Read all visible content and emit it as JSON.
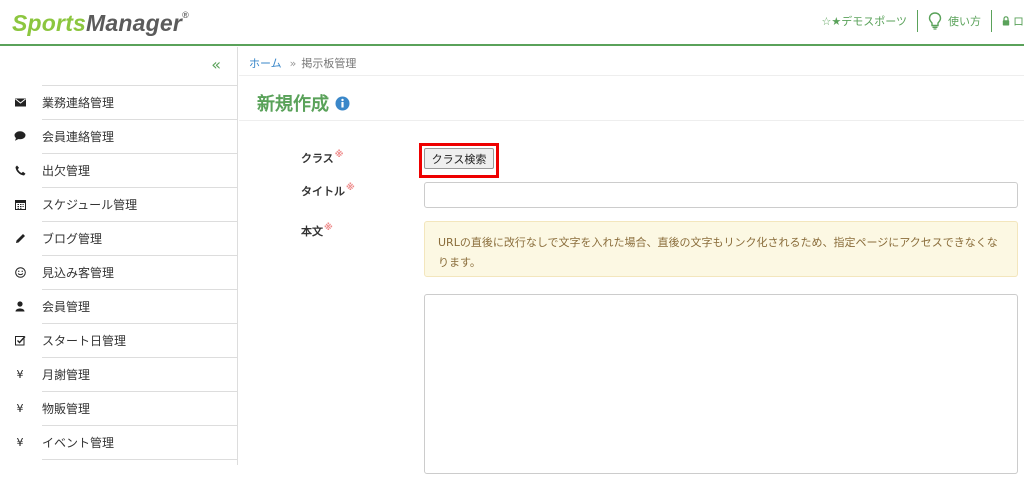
{
  "header": {
    "logo": {
      "sports": "Sports",
      "manager": "Manager"
    },
    "nav": {
      "org": "☆★デモスポーツ",
      "help": "使い方",
      "logout": "ロ"
    }
  },
  "sidebar": {
    "collapse_symbol": "«",
    "items": [
      {
        "label": "業務連絡管理",
        "icon": "envelope-icon"
      },
      {
        "label": "会員連絡管理",
        "icon": "comment-icon"
      },
      {
        "label": "出欠管理",
        "icon": "phone-icon"
      },
      {
        "label": "スケジュール管理",
        "icon": "calendar-icon"
      },
      {
        "label": "ブログ管理",
        "icon": "pencil-icon"
      },
      {
        "label": "見込み客管理",
        "icon": "smile-icon"
      },
      {
        "label": "会員管理",
        "icon": "user-icon"
      },
      {
        "label": "スタート日管理",
        "icon": "checkbox-icon"
      },
      {
        "label": "月謝管理",
        "icon": "yen-icon"
      },
      {
        "label": "物販管理",
        "icon": "yen-icon"
      },
      {
        "label": "イベント管理",
        "icon": "yen-icon"
      }
    ]
  },
  "breadcrumb": {
    "home": "ホーム",
    "separator": "»",
    "current": "掲示板管理"
  },
  "page": {
    "title": "新規作成"
  },
  "form": {
    "class_label": "クラス",
    "class_button": "クラス検索",
    "title_label": "タイトル",
    "title_value": "",
    "body_label": "本文",
    "body_value": "",
    "required_mark": "※",
    "notice": "URLの直後に改行なしで文字を入れた場合、直後の文字もリンク化されるため、指定ページにアクセスできなくなります。"
  },
  "colors": {
    "accent": "#5aa25a",
    "logo_green": "#8cc63f",
    "highlight": "#e00000",
    "link": "#3a87c9"
  }
}
